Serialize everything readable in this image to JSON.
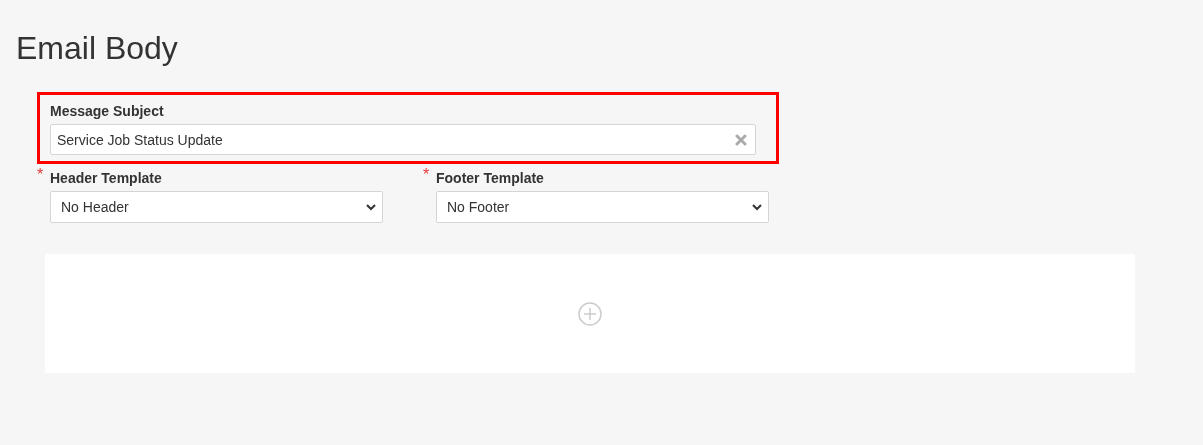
{
  "title": "Email Body",
  "subject": {
    "label": "Message Subject",
    "value": "Service Job Status Update",
    "highlighted": true
  },
  "templates": [
    {
      "label": "Header Template",
      "value": "No Header",
      "required": true,
      "required_mark": "*"
    },
    {
      "label": "Footer Template",
      "value": "No Footer",
      "required": true,
      "required_mark": "*"
    }
  ]
}
